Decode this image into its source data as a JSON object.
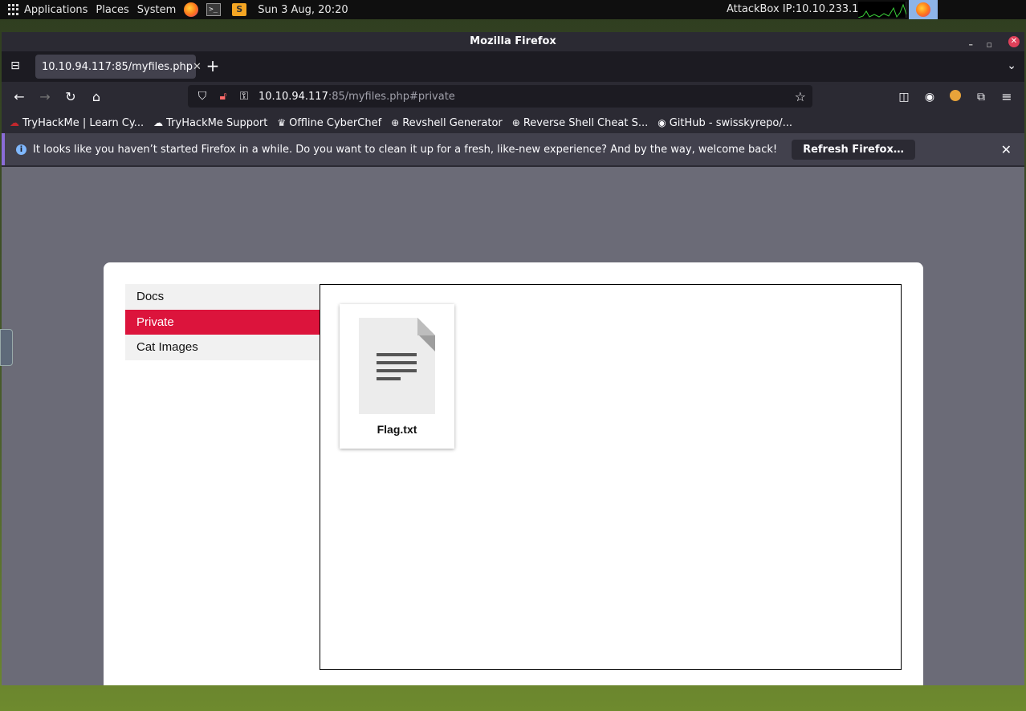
{
  "panel": {
    "applications": "Applications",
    "places": "Places",
    "system": "System",
    "datetime": "Sun 3 Aug, 20:20",
    "attackbox_ip": "AttackBox IP:10.10.233.108"
  },
  "window": {
    "title": "Mozilla Firefox"
  },
  "tab": {
    "title": "10.10.94.117:85/myfiles.php"
  },
  "urlbar": {
    "host": "10.10.94.117",
    "rest": ":85/myfiles.php#private"
  },
  "bookmarks": [
    {
      "label": "TryHackMe | Learn Cy...",
      "icon": "tryhackme-icon"
    },
    {
      "label": "TryHackMe Support",
      "icon": "support-icon"
    },
    {
      "label": "Offline CyberChef",
      "icon": "chef-icon"
    },
    {
      "label": "Revshell Generator",
      "icon": "globe-icon"
    },
    {
      "label": "Reverse Shell Cheat S...",
      "icon": "globe-icon"
    },
    {
      "label": "GitHub - swisskyrepo/...",
      "icon": "github-icon"
    }
  ],
  "infobar": {
    "message": "It looks like you haven’t started Firefox in a while. Do you want to clean it up for a fresh, like-new experience? And by the way, welcome back!",
    "button": "Refresh Firefox…"
  },
  "sidenav": {
    "items": [
      {
        "label": "Docs",
        "active": false
      },
      {
        "label": "Private",
        "active": true
      },
      {
        "label": "Cat Images",
        "active": false
      }
    ]
  },
  "files": [
    {
      "name": "Flag.txt",
      "icon": "document-icon"
    }
  ],
  "colors": {
    "accent_active": "#dc143c",
    "page_bg": "#6b6b77",
    "toolbar": "#2b2a33"
  }
}
